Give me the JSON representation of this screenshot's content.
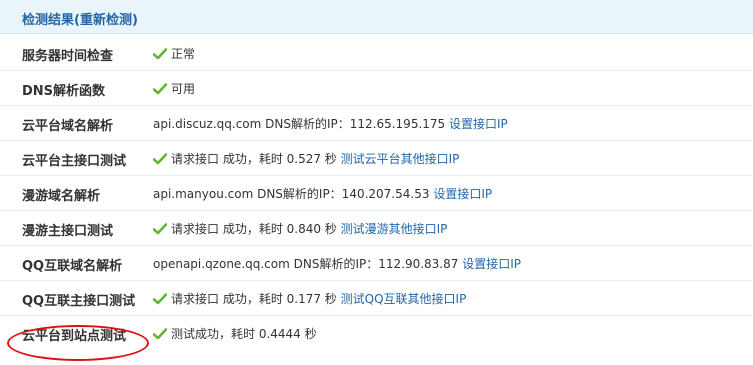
{
  "header": {
    "title_prefix": "检测结果(",
    "recheck_link": "重新检测",
    "title_suffix": ")"
  },
  "colors": {
    "accent": "#2366a8",
    "check": "#5cb82e",
    "highlight": "#e01010"
  },
  "rows": [
    {
      "label": "服务器时间检查",
      "status_icon": "check-icon",
      "text": "正常",
      "link": ""
    },
    {
      "label": "DNS解析函数",
      "status_icon": "check-icon",
      "text": "可用",
      "link": ""
    },
    {
      "label": "云平台域名解析",
      "status_icon": "",
      "text": "api.discuz.qq.com DNS解析的IP：112.65.195.175",
      "link": "设置接口IP"
    },
    {
      "label": "云平台主接口测试",
      "status_icon": "check-icon",
      "text": "请求接口 成功，耗时 0.527 秒",
      "link": "测试云平台其他接口IP"
    },
    {
      "label": "漫游域名解析",
      "status_icon": "",
      "text": "api.manyou.com DNS解析的IP：140.207.54.53",
      "link": "设置接口IP"
    },
    {
      "label": "漫游主接口测试",
      "status_icon": "check-icon",
      "text": "请求接口 成功，耗时 0.840 秒",
      "link": "测试漫游其他接口IP"
    },
    {
      "label": "QQ互联域名解析",
      "status_icon": "",
      "text": "openapi.qzone.qq.com DNS解析的IP：112.90.83.87",
      "link": "设置接口IP"
    },
    {
      "label": "QQ互联主接口测试",
      "status_icon": "check-icon",
      "text": "请求接口 成功，耗时 0.177 秒",
      "link": "测试QQ互联其他接口IP"
    },
    {
      "label": "云平台到站点测试",
      "status_icon": "check-icon",
      "text": "测试成功，耗时 0.4444 秒",
      "link": ""
    }
  ]
}
